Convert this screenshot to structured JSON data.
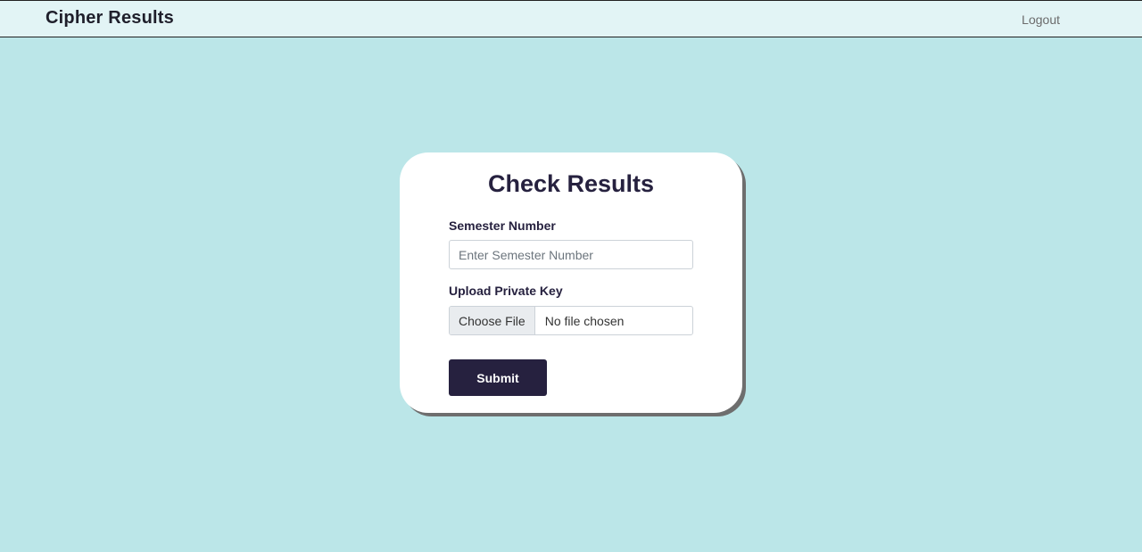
{
  "navbar": {
    "brand": "Cipher Results",
    "logout_label": "Logout"
  },
  "form": {
    "title": "Check Results",
    "semester_label": "Semester Number",
    "semester_placeholder": "Enter Semester Number",
    "semester_value": "",
    "key_label": "Upload Private Key",
    "file_button_label": "Choose File",
    "file_status": "No file chosen",
    "submit_label": "Submit"
  },
  "colors": {
    "page_background": "#bbe6e8",
    "navbar_background": "#e2f4f5",
    "accent": "#26213f",
    "card_background": "#ffffff"
  }
}
